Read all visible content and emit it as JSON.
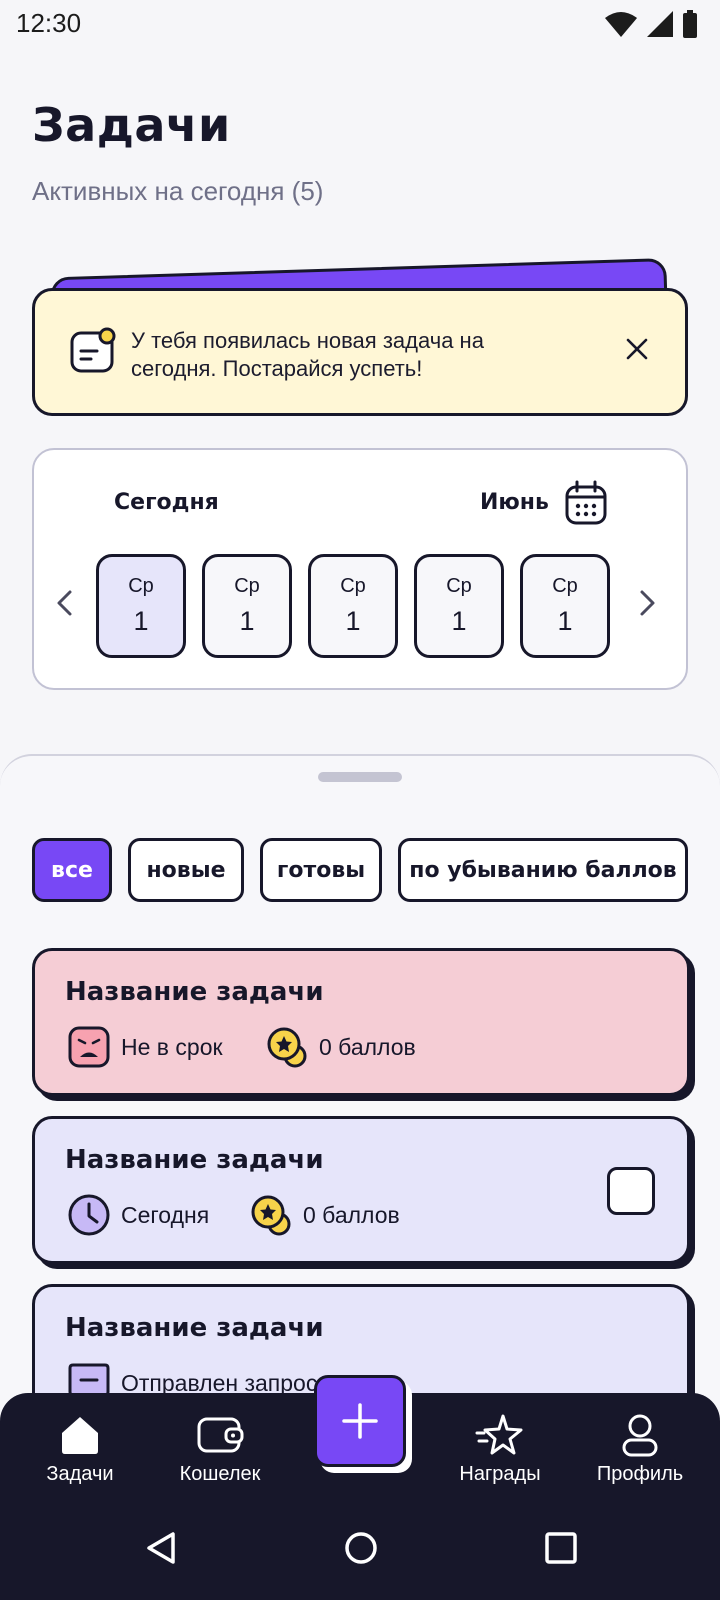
{
  "status_bar": {
    "time": "12:30"
  },
  "header": {
    "title": "Задачи",
    "subtitle": "Активных на сегодня (5)"
  },
  "banner": {
    "text": "У тебя появилась новая задача на сегодня. Постарайся успеть!"
  },
  "calendar": {
    "today_label": "Сегодня",
    "month_label": "Июнь",
    "days": [
      {
        "name": "Ср",
        "number": "1",
        "selected": true
      },
      {
        "name": "Ср",
        "number": "1",
        "selected": false
      },
      {
        "name": "Ср",
        "number": "1",
        "selected": false
      },
      {
        "name": "Ср",
        "number": "1",
        "selected": false
      },
      {
        "name": "Ср",
        "number": "1",
        "selected": false
      }
    ]
  },
  "filters": {
    "all": "все",
    "new": "новые",
    "done": "готовы",
    "sort": "по убыванию баллов"
  },
  "tasks": [
    {
      "title": "Название задачи",
      "status": "Не в срок",
      "points": "0 баллов"
    },
    {
      "title": "Название задачи",
      "status": "Сегодня",
      "points": "0 баллов"
    },
    {
      "title": "Название задачи",
      "status": "Отправлен запрос"
    }
  ],
  "nav": {
    "tasks": "Задачи",
    "wallet": "Кошелек",
    "rewards": "Награды",
    "profile": "Профиль"
  },
  "colors": {
    "accent": "#7848f5",
    "dark": "#17172a",
    "banner_bg": "#fff7d6",
    "overdue_bg": "#f5cdd5",
    "task_bg": "#e6e5fa"
  }
}
